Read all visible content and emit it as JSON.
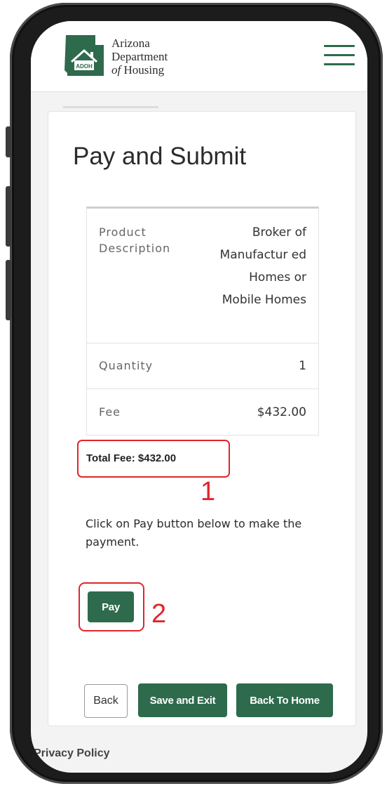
{
  "header": {
    "org_line1": "Arizona",
    "org_line2": "Department",
    "org_line3_prefix": "of",
    "org_line3_rest": " Housing",
    "logo_text": "ADOH"
  },
  "main": {
    "title": "Pay and Submit",
    "table": [
      {
        "label": "Product Description",
        "value": "Broker of Manufactur ed Homes or Mobile Homes"
      },
      {
        "label": "Quantity",
        "value": "1"
      },
      {
        "label": "Fee",
        "value": "$432.00"
      }
    ],
    "total_fee": "Total Fee: $432.00",
    "instruction": "Click on Pay button below to make the payment.",
    "pay_label": "Pay",
    "back_label": "Back",
    "save_exit_label": "Save and Exit",
    "back_home_label": "Back To Home"
  },
  "annotations": {
    "callout_1": "1",
    "callout_2": "2"
  },
  "footer": {
    "privacy_link": "Privacy Policy"
  },
  "colors": {
    "brand_green": "#2e6a4c",
    "callout_red": "#e2252b"
  },
  "icons": {
    "menu": "hamburger-menu-icon",
    "logo": "adoh-house-logo-icon"
  }
}
